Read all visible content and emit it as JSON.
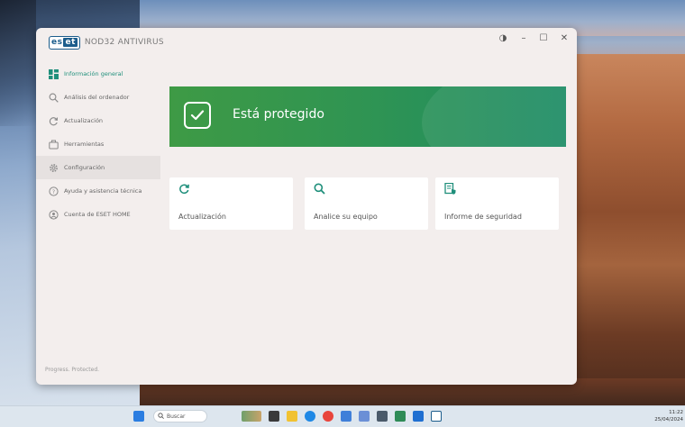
{
  "window": {
    "logo_text_left": "es",
    "logo_text_right": "et",
    "product_name": "NOD32 ANTIVIRUS",
    "controls": {
      "theme": "◑",
      "minimize": "–",
      "maximize": "☐",
      "close": "✕"
    }
  },
  "sidebar": {
    "items": [
      {
        "label": "Información general",
        "icon": "dashboard-icon",
        "active": true
      },
      {
        "label": "Análisis del ordenador",
        "icon": "search-icon"
      },
      {
        "label": "Actualización",
        "icon": "refresh-icon"
      },
      {
        "label": "Herramientas",
        "icon": "briefcase-icon"
      },
      {
        "label": "Configuración",
        "icon": "gear-icon",
        "hover": true
      },
      {
        "label": "Ayuda y asistencia técnica",
        "icon": "help-icon"
      },
      {
        "label": "Cuenta de ESET HOME",
        "icon": "account-icon"
      }
    ],
    "footer": "Progress. Protected."
  },
  "status": {
    "text": "Está protegido",
    "color": "#2f9453"
  },
  "tiles": [
    {
      "label": "Actualización",
      "icon": "refresh-icon"
    },
    {
      "label": "Analice su equipo",
      "icon": "search-icon"
    },
    {
      "label": "Informe de seguridad",
      "icon": "report-icon"
    }
  ],
  "taskbar": {
    "search_placeholder": "Buscar",
    "time": "11:22",
    "date": "25/04/2024"
  },
  "colors": {
    "accent": "#1f8f7b",
    "banner_green": "#2f9453",
    "logo_blue": "#1c5d8c"
  }
}
